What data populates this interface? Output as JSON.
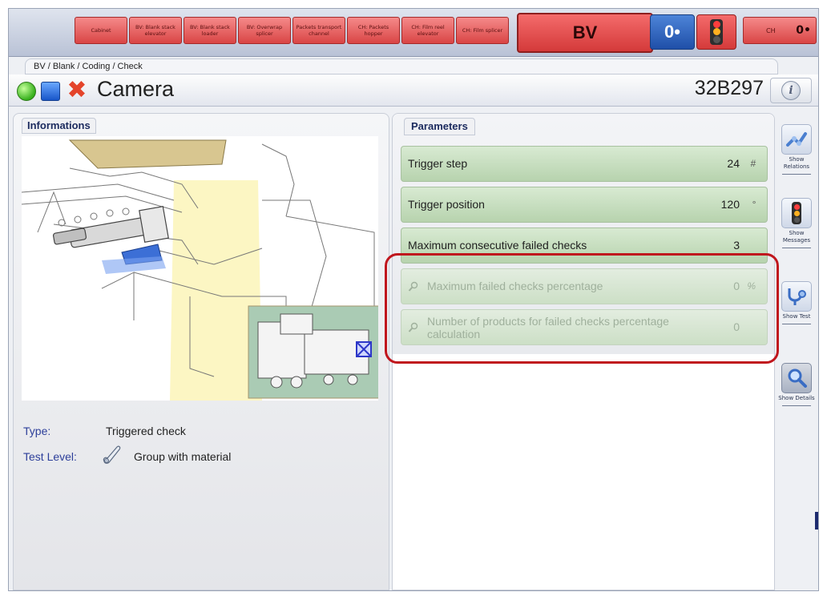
{
  "topbar": {
    "stations": [
      {
        "label": "Cabinet"
      },
      {
        "label": "BV: Blank stack elevator"
      },
      {
        "label": "BV: Blank stack loader"
      },
      {
        "label": "BV: Overwrap splicer"
      },
      {
        "label": "Packets transport channel"
      },
      {
        "label": "CH: Packets hopper"
      },
      {
        "label": "CH: Film reel elevator"
      },
      {
        "label": "CH: Film splicer"
      }
    ],
    "active_station": "BV",
    "active_counter": "0•",
    "ch_label": "CH",
    "ch_counter": "0•",
    "status_color": "#d94545",
    "counter_color": "#1f4fa8"
  },
  "breadcrumb": "BV / Blank / Coding / Check",
  "title": {
    "text": "Camera",
    "machine_id": "32B297",
    "status_icons": [
      "green-status-icon",
      "blue-square-icon",
      "red-x-icon"
    ],
    "info_icon": "i"
  },
  "info_panel": {
    "title": "Informations",
    "type_label": "Type:",
    "type_value": "Triggered check",
    "testlevel_label": "Test Level:",
    "testlevel_value": "Group with material"
  },
  "param_panel": {
    "title": "Parameters",
    "rows": [
      {
        "name": "Trigger step",
        "value": "24",
        "unit": "#",
        "enabled": true
      },
      {
        "name": "Trigger position",
        "value": "120",
        "unit": "°",
        "enabled": true
      },
      {
        "name": "Maximum consecutive failed checks",
        "value": "3",
        "unit": "",
        "enabled": true
      },
      {
        "name": "Maximum failed checks percentage",
        "value": "0",
        "unit": "%",
        "enabled": false
      },
      {
        "name": "Number of products for failed checks percentage calculation",
        "value": "0",
        "unit": "",
        "enabled": false
      }
    ],
    "highlight_color": "#c0161d"
  },
  "toolbar": {
    "buttons": [
      {
        "label": "Show Relations",
        "icon": "relations-icon"
      },
      {
        "label": "Show Messages",
        "icon": "traffic-light-icon"
      },
      {
        "label": "Show Test",
        "icon": "stethoscope-icon"
      },
      {
        "label": "Show Details",
        "icon": "magnifier-icon"
      }
    ]
  }
}
